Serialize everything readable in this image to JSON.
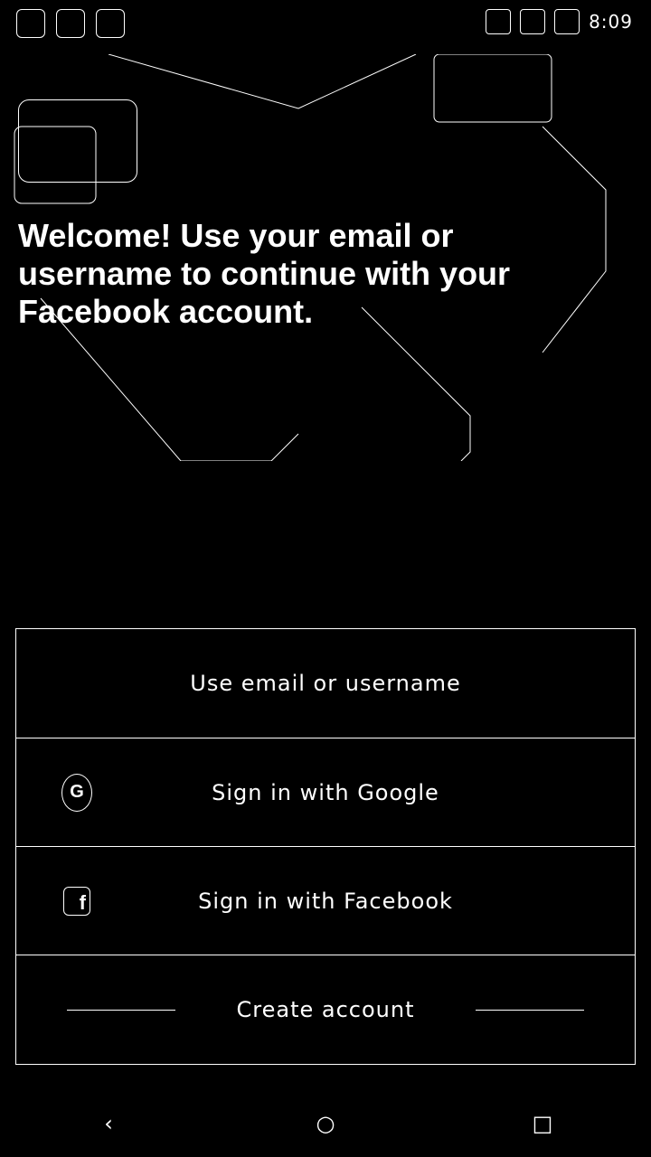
{
  "status_bar": {
    "time": "8:09"
  },
  "hero": {
    "headline": "Welcome! Use your email or username to continue with your Facebook account."
  },
  "login_options": {
    "email": {
      "label": "Use email or username"
    },
    "google": {
      "label": "Sign in with Google"
    },
    "facebook": {
      "label": "Sign in with Facebook"
    },
    "create": {
      "label": "Create account"
    }
  },
  "icons": {
    "google": "google-icon",
    "facebook": "facebook-icon",
    "back": "back-icon",
    "home": "home-icon",
    "recents": "recents-icon"
  },
  "colors": {
    "background": "#000000",
    "foreground": "#ffffff"
  }
}
